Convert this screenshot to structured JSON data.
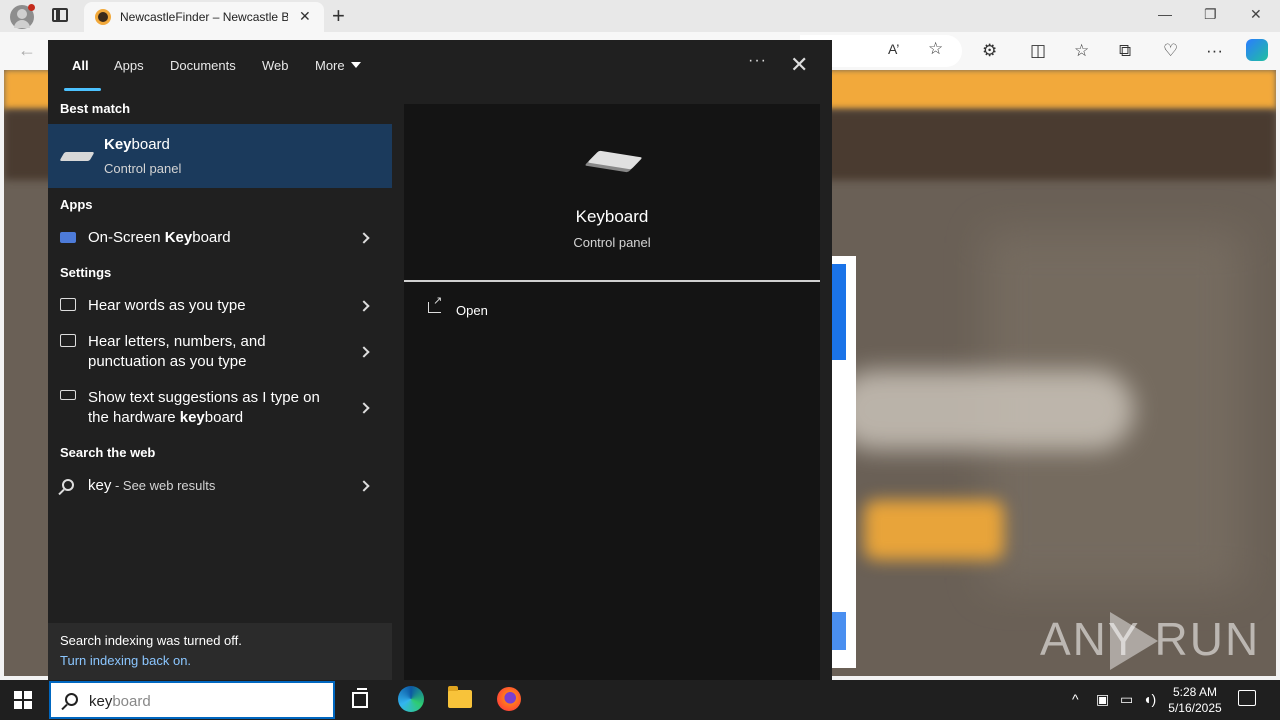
{
  "browser": {
    "tab_title": "NewcastleFinder – Newcastle Bu",
    "tab_close": "✕",
    "new_tab": "+",
    "minimize": "—",
    "restore": "❐",
    "close": "✕",
    "toolbar_icons": {
      "read_aloud": "A’",
      "favorite": "☆",
      "extensions": "⚙",
      "split": "◫",
      "favorites": "☆",
      "collections": "⧉",
      "performance": "♡",
      "more": "···"
    }
  },
  "search_panel": {
    "tabs": [
      {
        "label": "All",
        "active": true
      },
      {
        "label": "Apps"
      },
      {
        "label": "Documents"
      },
      {
        "label": "Web"
      },
      {
        "label": "More"
      }
    ],
    "more_options": "···",
    "close": "✕",
    "best_match": {
      "section": "Best match",
      "title_bold": "Key",
      "title_rest": "board",
      "subtitle": "Control panel"
    },
    "apps_section": "Apps",
    "apps": [
      {
        "pre": "On-Screen ",
        "bold": "Key",
        "post": "board"
      }
    ],
    "settings_section": "Settings",
    "settings": [
      {
        "line1": "Hear words as you type",
        "line2": ""
      },
      {
        "line1": "Hear letters, numbers, and",
        "line2": "punctuation as you type"
      },
      {
        "line1": "Show text suggestions as I type on",
        "line2_pre": "the hardware ",
        "line2_bold": "key",
        "line2_post": "board"
      }
    ],
    "web_section": "Search the web",
    "web_result": {
      "query": "key",
      "suffix": " - See web results"
    },
    "index_note": {
      "line1": "Search indexing was turned off.",
      "line2": "Turn indexing back on."
    },
    "preview": {
      "title": "Keyboard",
      "subtitle": "Control panel",
      "action": "Open"
    }
  },
  "taskbar": {
    "search_typed": "key",
    "search_ghost": "board",
    "time": "5:28 AM",
    "date": "5/16/2025"
  },
  "watermark": "ANY RUN",
  "colors": {
    "panel_bg": "#202020",
    "selected_bg": "#1b3a5c",
    "accent": "#4cc2ff",
    "link": "#8bc6ff"
  }
}
